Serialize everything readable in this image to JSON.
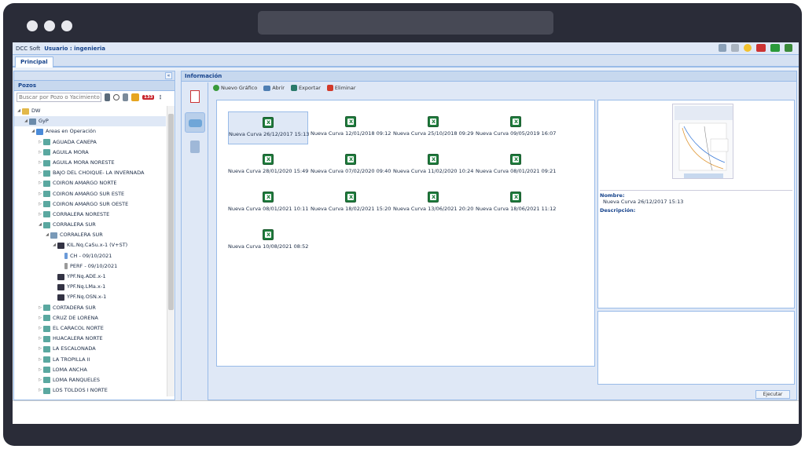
{
  "app": {
    "name": "DCC Soft",
    "user": "Usuario : ingenieria",
    "tab": "Principal"
  },
  "colors": {
    "accent": "#15428b",
    "panel_header": "#c7d8ee",
    "excel_green": "#1e7c3c"
  },
  "left": {
    "title": "Pozos",
    "search_placeholder": "Buscar por Pozo o Yacimiento",
    "badge_count": "133",
    "tree": [
      {
        "label": "DW",
        "indent": 0,
        "icon": "folder-icon"
      },
      {
        "label": "GyP",
        "indent": 1,
        "icon": "company-icon",
        "selected": true
      },
      {
        "label": "Areas en Operación",
        "indent": 2,
        "icon": "area-icon"
      },
      {
        "label": "AGUADA CANEPA",
        "indent": 3,
        "icon": "field-icon"
      },
      {
        "label": "AGUILA MORA",
        "indent": 3,
        "icon": "field-icon"
      },
      {
        "label": "AGUILA MORA NORESTE",
        "indent": 3,
        "icon": "field-icon"
      },
      {
        "label": "BAJO DEL CHOIQUE- LA INVERNADA",
        "indent": 3,
        "icon": "field-icon"
      },
      {
        "label": "COIRON AMARGO NORTE",
        "indent": 3,
        "icon": "field-icon"
      },
      {
        "label": "COIRON AMARGO SUR ESTE",
        "indent": 3,
        "icon": "field-icon"
      },
      {
        "label": "COIRON AMARGO SUR OESTE",
        "indent": 3,
        "icon": "field-icon"
      },
      {
        "label": "CORRALERA NORESTE",
        "indent": 3,
        "icon": "field-icon"
      },
      {
        "label": "CORRALERA SUR",
        "indent": 3,
        "icon": "field-icon"
      },
      {
        "label": "CORRALERA SUR",
        "indent": 4,
        "icon": "block-icon"
      },
      {
        "label": "KIL.Nq.CaSu.x-1 (V+ST)",
        "indent": 5,
        "icon": "well-icon"
      },
      {
        "label": "CH - 09/10/2021",
        "indent": 6,
        "icon": "bar-icon"
      },
      {
        "label": "PERF - 09/10/2021",
        "indent": 6,
        "icon": "doc-icon"
      },
      {
        "label": "YPF.Nq.ADE.x-1",
        "indent": 5,
        "icon": "well-icon"
      },
      {
        "label": "YPF.Nq.LMa.x-1",
        "indent": 5,
        "icon": "well-icon"
      },
      {
        "label": "YPF.Nq.OSN.x-1",
        "indent": 5,
        "icon": "well-icon"
      },
      {
        "label": "CORTADERA SUR",
        "indent": 3,
        "icon": "field-icon"
      },
      {
        "label": "CRUZ DE LORENA",
        "indent": 3,
        "icon": "field-icon"
      },
      {
        "label": "EL CARACOL NORTE",
        "indent": 3,
        "icon": "field-icon"
      },
      {
        "label": "HUACALERA NORTE",
        "indent": 3,
        "icon": "field-icon"
      },
      {
        "label": "LA ESCALONADA",
        "indent": 3,
        "icon": "field-icon"
      },
      {
        "label": "LA TROPILLA II",
        "indent": 3,
        "icon": "field-icon"
      },
      {
        "label": "LOMA ANCHA",
        "indent": 3,
        "icon": "field-icon"
      },
      {
        "label": "LOMA RANQUELES",
        "indent": 3,
        "icon": "field-icon"
      },
      {
        "label": "LOS TOLDOS I NORTE",
        "indent": 3,
        "icon": "field-icon"
      }
    ]
  },
  "right": {
    "title": "Información",
    "toolbar": {
      "new": "Nuevo Gráfico",
      "open": "Abrir",
      "export": "Exportar",
      "delete": "Eliminar"
    },
    "files": [
      "Nueva Curva 26/12/2017 15:13",
      "Nueva Curva 12/01/2018 09:12",
      "Nueva Curva 25/10/2018 09:29",
      "Nueva Curva 09/05/2019 16:07",
      "Nueva Curva 28/01/2020 15:49",
      "Nueva Curva 07/02/2020 09:40",
      "Nueva Curva 11/02/2020 10:24",
      "Nueva Curva 08/01/2021 09:21",
      "Nueva Curva 08/01/2021 10:11",
      "Nueva Curva 18/02/2021 15:20",
      "Nueva Curva 13/06/2021 20:20",
      "Nueva Curva 18/06/2021 11:12",
      "Nueva Curva 10/08/2021 08:52"
    ],
    "details": {
      "name_label": "Nombre:",
      "name_value": "Nueva Curva 26/12/2017 15:13",
      "desc_label": "Descripción:"
    },
    "execute": "Ejecutar"
  }
}
